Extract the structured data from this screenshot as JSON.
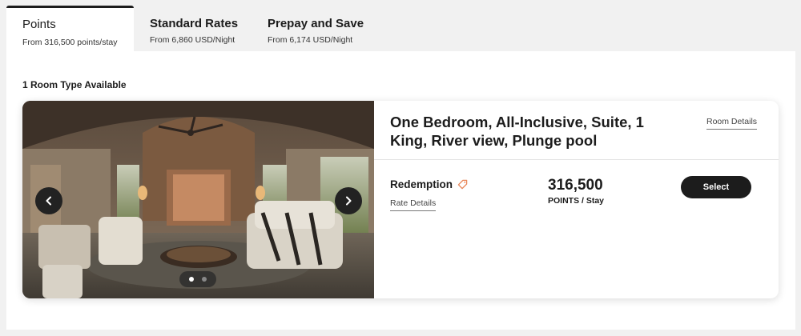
{
  "tabs": [
    {
      "title": "Points",
      "subtitle": "From 316,500 points/stay",
      "active": true
    },
    {
      "title": "Standard Rates",
      "subtitle": "From 6,860 USD/Night",
      "active": false
    },
    {
      "title": "Prepay and Save",
      "subtitle": "From 6,174 USD/Night",
      "active": false
    }
  ],
  "availability": "1 Room Type Available",
  "room": {
    "name": "One Bedroom, All-Inclusive, Suite, 1 King, River view, Plunge pool",
    "details_link": "Room Details",
    "rate_name": "Redemption",
    "rate_details_link": "Rate Details",
    "price": "316,500",
    "price_unit": "POINTS / Stay",
    "select_label": "Select"
  },
  "carousel": {
    "slide_count": 2,
    "current": 1
  },
  "icons": {
    "prev": "chevron-left-icon",
    "next": "chevron-right-icon",
    "tag": "tag-icon"
  },
  "colors": {
    "accent_tag": "#e8875a",
    "primary_button": "#1c1c1c"
  }
}
